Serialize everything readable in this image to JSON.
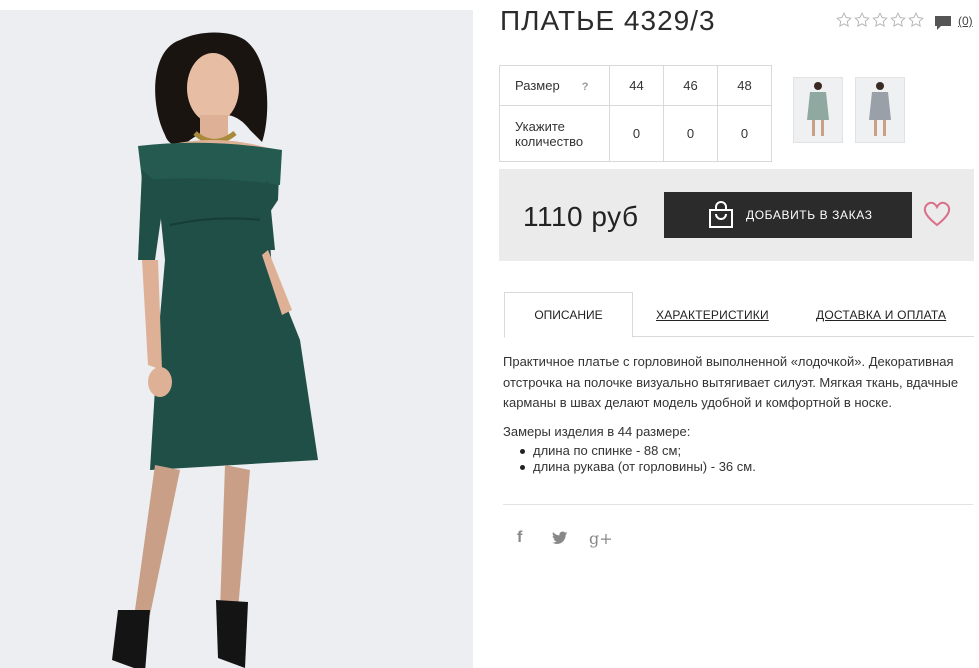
{
  "product": {
    "title": "ПЛАТЬЕ 4329/3",
    "rating": 0,
    "rating_max": 5,
    "comment_count": "(0)"
  },
  "size_table": {
    "size_label": "Размер",
    "help": "?",
    "sizes": [
      "44",
      "46",
      "48"
    ],
    "qty_label_line1": "Укажите",
    "qty_label_line2": "количество",
    "quantities": [
      "0",
      "0",
      "0"
    ]
  },
  "buy": {
    "price": "1110 руб",
    "add_label": "ДОБАВИТЬ В ЗАКАЗ"
  },
  "tabs": [
    {
      "label": "ОПИСАНИЕ",
      "active": true
    },
    {
      "label": "ХАРАКТЕРИСТИКИ",
      "active": false
    },
    {
      "label": "ДОСТАВКА И ОПЛАТА",
      "active": false
    }
  ],
  "description": {
    "text": "Практичное платье с горловиной выполненной «лодочкой». Декоративная отстрочка на полочке визуально вытягивает силуэт. Мягкая ткань, вдачные карманы в швах делают модель удобной и комфортной в носке.",
    "measure_title": "Замеры изделия в 44 размере:",
    "measures": [
      "длина по спинке - 88 см;",
      "длина рукава (от горловины) - 36 см."
    ]
  },
  "social": {
    "facebook": "f",
    "twitter": "twitter-icon",
    "googleplus": "g+"
  },
  "colors": {
    "dress": "#1f4f46",
    "button": "#2b2b2b",
    "heart": "#d9708a",
    "panel": "#ebebeb"
  }
}
